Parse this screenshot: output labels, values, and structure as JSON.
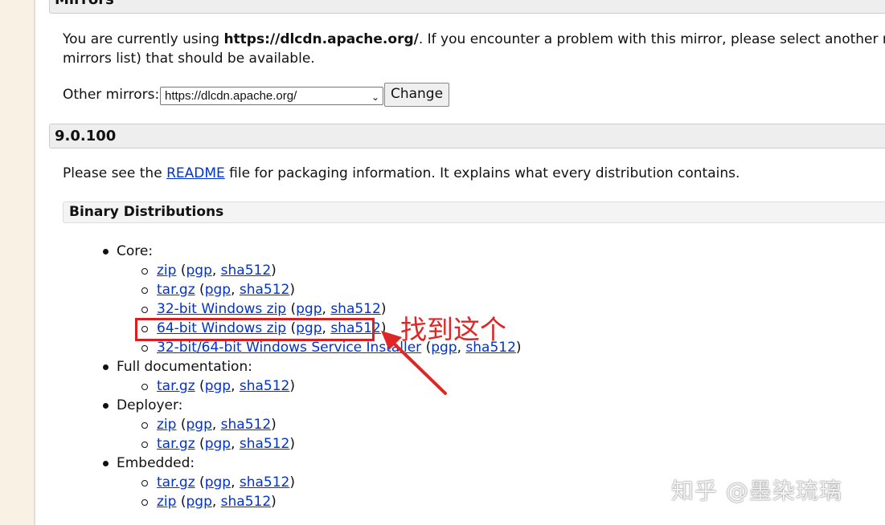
{
  "mirrors": {
    "header": "Mirrors",
    "line1_prefix": "You are currently using ",
    "current_mirror": "https://dlcdn.apache.org/",
    "line1_suffix": ". If you encounter a problem with this mirror, please select another mirror.",
    "line2": "mirrors list) that should be available.",
    "other_label": "Other mirrors: ",
    "select_value": "https://dlcdn.apache.org/",
    "change_button": "Change"
  },
  "version": {
    "header": "9.0.100",
    "readme_prefix": "Please see the ",
    "readme_link": "README",
    "readme_suffix": " file for packaging information. It explains what every distribution contains.",
    "binary_header": "Binary Distributions"
  },
  "distributions": [
    {
      "label": "Core:",
      "items": [
        {
          "name": "zip",
          "sig": "pgp",
          "hash": "sha512"
        },
        {
          "name": "tar.gz",
          "sig": "pgp",
          "hash": "sha512"
        },
        {
          "name": "32-bit Windows zip",
          "sig": "pgp",
          "hash": "sha512"
        },
        {
          "name": "64-bit Windows zip",
          "sig": "pgp",
          "hash": "sha512"
        },
        {
          "name": "32-bit/64-bit Windows Service Installer",
          "sig": "pgp",
          "hash": "sha512"
        }
      ]
    },
    {
      "label": "Full documentation:",
      "items": [
        {
          "name": "tar.gz",
          "sig": "pgp",
          "hash": "sha512"
        }
      ]
    },
    {
      "label": "Deployer:",
      "items": [
        {
          "name": "zip",
          "sig": "pgp",
          "hash": "sha512"
        },
        {
          "name": "tar.gz",
          "sig": "pgp",
          "hash": "sha512"
        }
      ]
    },
    {
      "label": "Embedded:",
      "items": [
        {
          "name": "tar.gz",
          "sig": "pgp",
          "hash": "sha512"
        },
        {
          "name": "zip",
          "sig": "pgp",
          "hash": "sha512"
        }
      ]
    }
  ],
  "annotation": {
    "text": "找到这个",
    "color": "#e02525"
  },
  "watermark": "知乎 @墨染琉璃",
  "colors": {
    "link": "#0033cc",
    "sidebar": "#f8f1e4",
    "highlight": "#d92020"
  }
}
